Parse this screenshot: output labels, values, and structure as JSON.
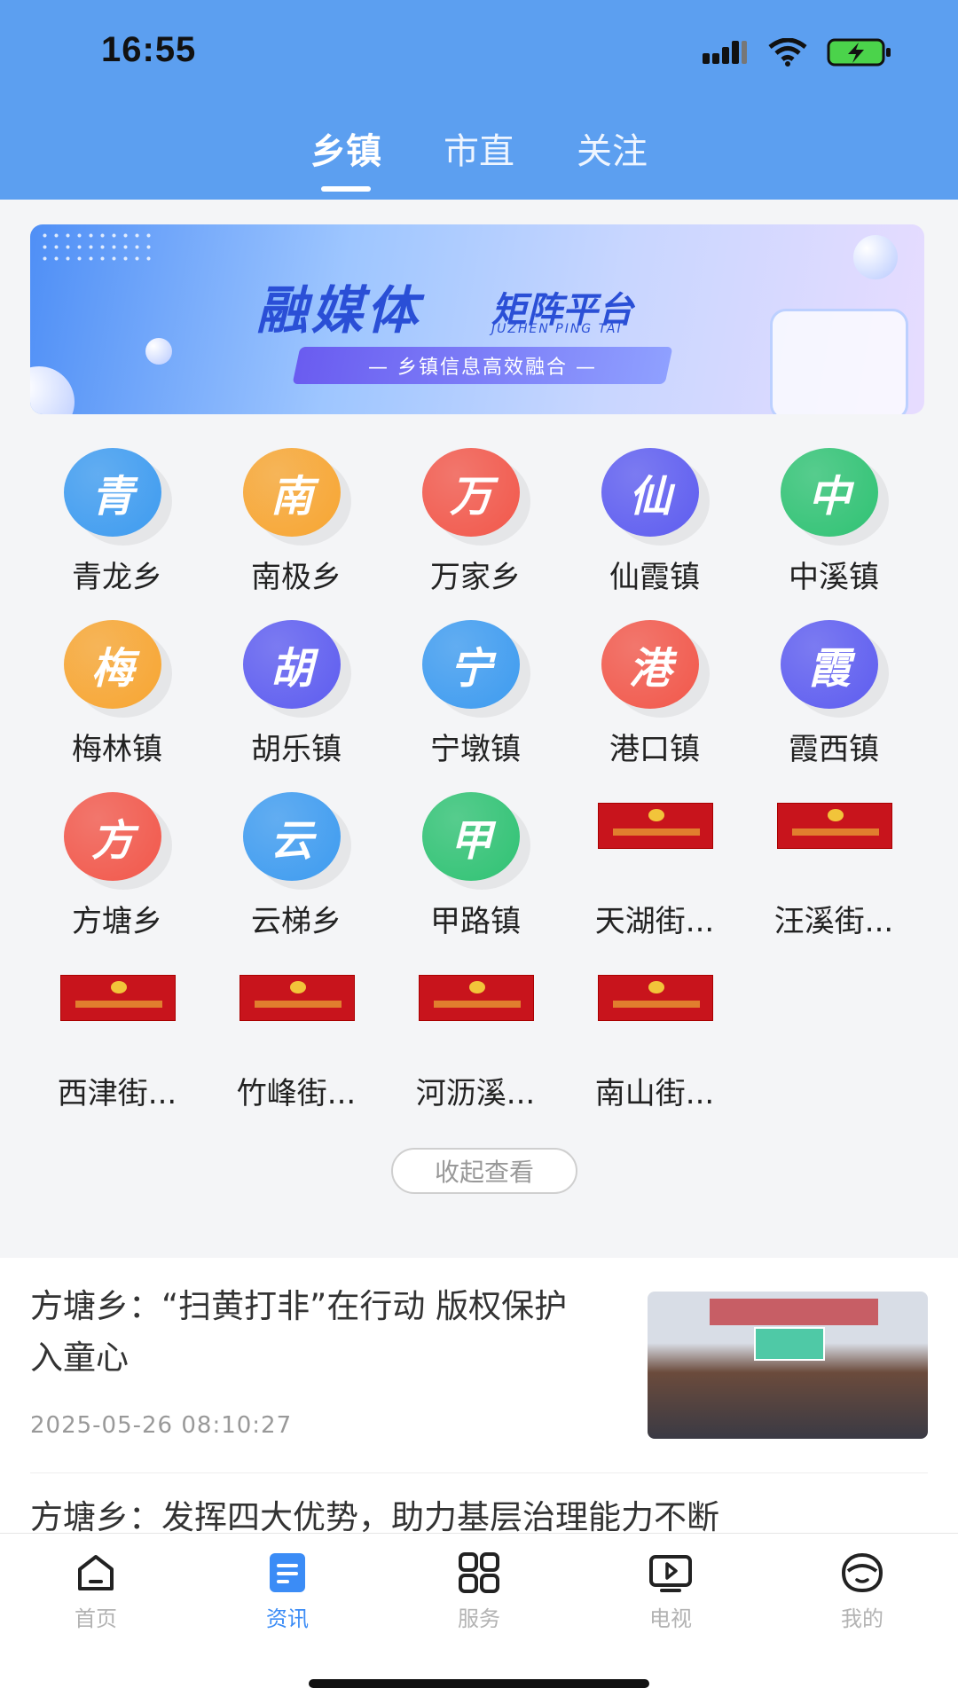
{
  "status_bar": {
    "time": "16:55"
  },
  "tabs": [
    {
      "label": "乡镇",
      "active": true
    },
    {
      "label": "市直",
      "active": false
    },
    {
      "label": "关注",
      "active": false
    }
  ],
  "banner": {
    "title": "融媒体",
    "title2": "矩阵平台",
    "subtitle_en": "JUZHEN PING TAI",
    "tagline": "— 乡镇信息高效融合 —"
  },
  "towns": [
    {
      "label": "青龙乡",
      "char": "青",
      "color": "#3d9bf0"
    },
    {
      "label": "南极乡",
      "char": "南",
      "color": "#f7a531"
    },
    {
      "label": "万家乡",
      "char": "万",
      "color": "#f2574a"
    },
    {
      "label": "仙霞镇",
      "char": "仙",
      "color": "#5d5cf0"
    },
    {
      "label": "中溪镇",
      "char": "中",
      "color": "#2fc273"
    },
    {
      "label": "梅林镇",
      "char": "梅",
      "color": "#f7a531"
    },
    {
      "label": "胡乐镇",
      "char": "胡",
      "color": "#5d5cf0"
    },
    {
      "label": "宁墩镇",
      "char": "宁",
      "color": "#3d9bf0"
    },
    {
      "label": "港口镇",
      "char": "港",
      "color": "#f2574a"
    },
    {
      "label": "霞西镇",
      "char": "霞",
      "color": "#5d5cf0"
    },
    {
      "label": "方塘乡",
      "char": "方",
      "color": "#f2574a"
    },
    {
      "label": "云梯乡",
      "char": "云",
      "color": "#3d9bf0"
    },
    {
      "label": "甲路镇",
      "char": "甲",
      "color": "#2fc273"
    },
    {
      "label": "天湖街...",
      "char": "",
      "color": ""
    },
    {
      "label": "汪溪街...",
      "char": "",
      "color": ""
    },
    {
      "label": "西津街...",
      "char": "",
      "color": ""
    },
    {
      "label": "竹峰街...",
      "char": "",
      "color": ""
    },
    {
      "label": "河沥溪...",
      "char": "",
      "color": ""
    },
    {
      "label": "南山街...",
      "char": "",
      "color": ""
    }
  ],
  "collapse_label": "收起查看",
  "news": [
    {
      "title": "方塘乡：“扫黄打非”在行动 版权保护入童心",
      "time": "2025-05-26 08:10:27"
    },
    {
      "title": "方塘乡：发挥四大优势，助力基层治理能力不断"
    }
  ],
  "bottom_nav": [
    {
      "label": "首页",
      "icon": "home-icon",
      "active": false
    },
    {
      "label": "资讯",
      "icon": "news-icon",
      "active": true
    },
    {
      "label": "服务",
      "icon": "grid-icon",
      "active": false
    },
    {
      "label": "电视",
      "icon": "tv-icon",
      "active": false
    },
    {
      "label": "我的",
      "icon": "profile-icon",
      "active": false
    }
  ],
  "colors": {
    "header": "#5c9ff0",
    "accent": "#3b8cf6"
  }
}
